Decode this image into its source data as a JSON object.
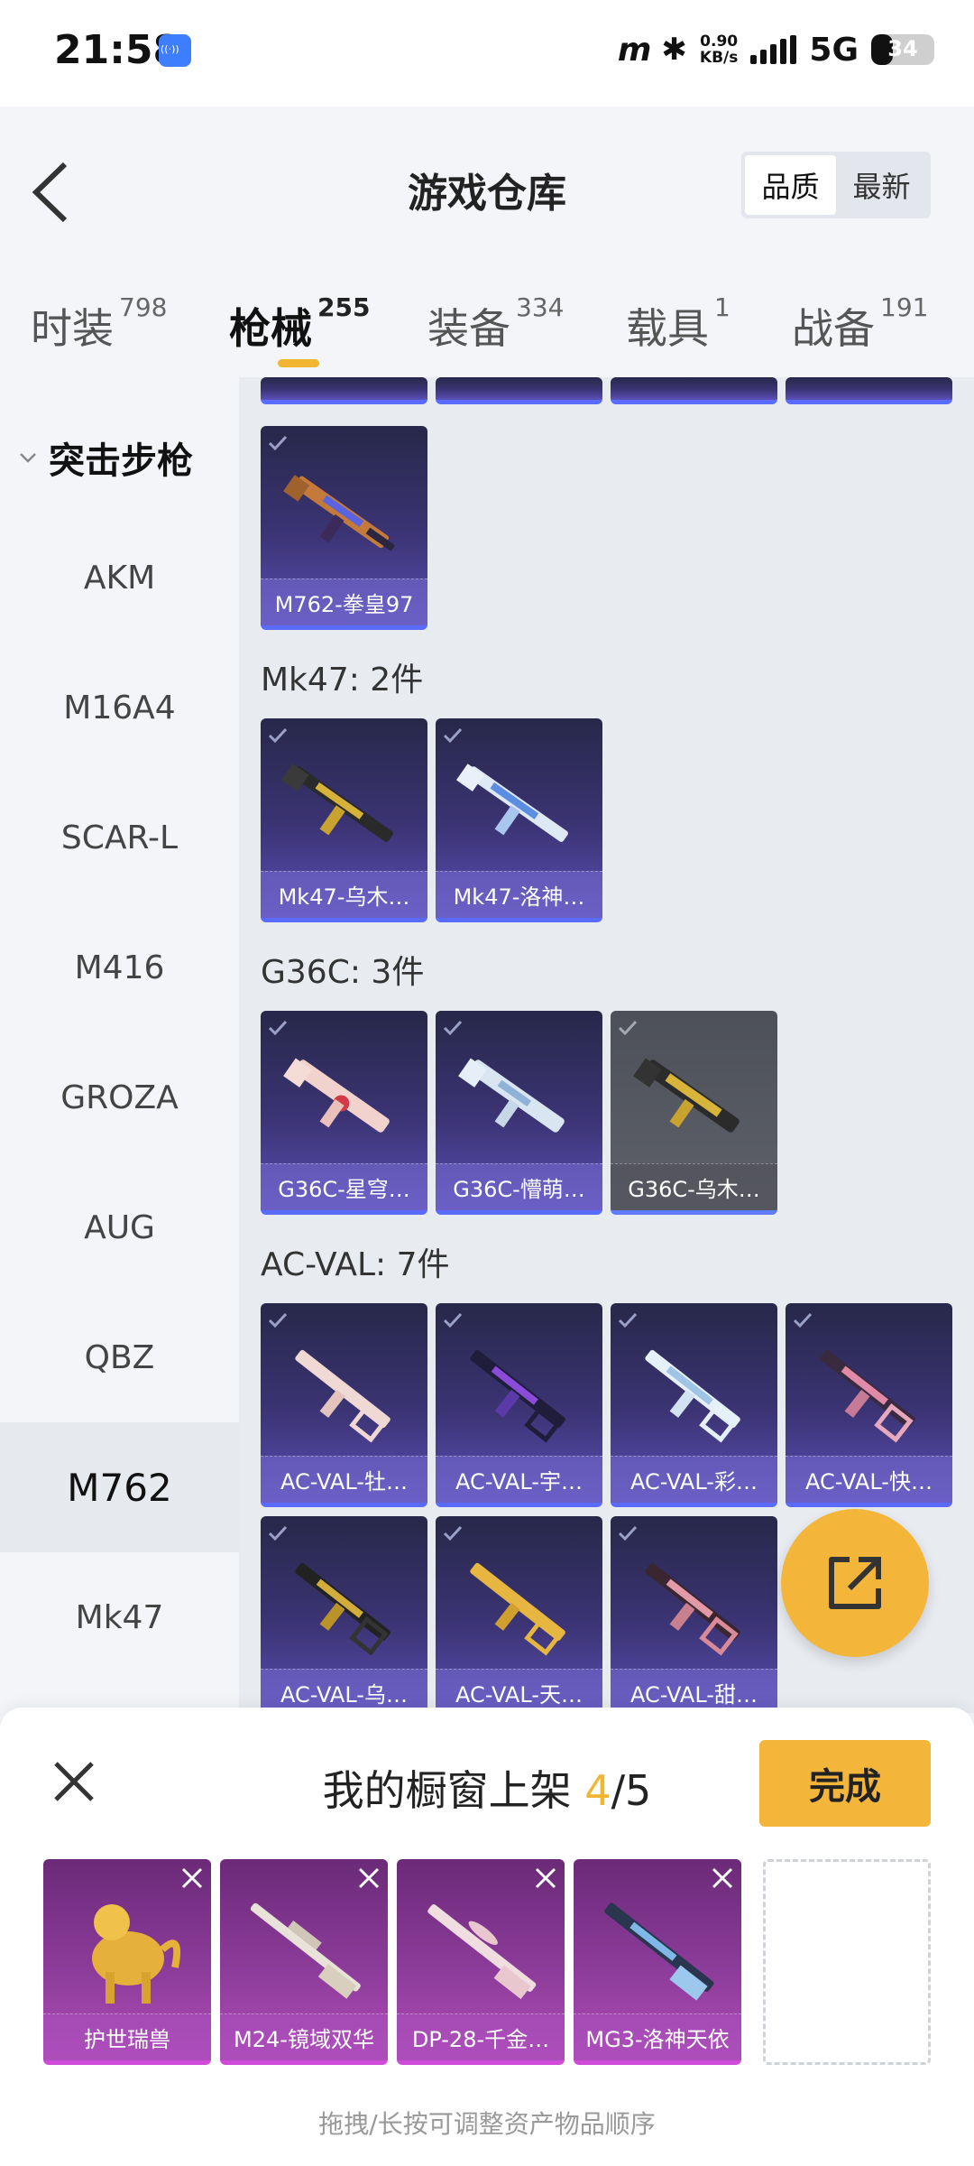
{
  "status_bar": {
    "time": "21:58",
    "speed_value": "0.90",
    "speed_unit": "KB/s",
    "network": "5G",
    "battery": "34",
    "battery_level": 0.34
  },
  "header": {
    "title": "游戏仓库",
    "sort_options": [
      "品质",
      "最新"
    ],
    "sort_selected": "品质"
  },
  "tabs": [
    {
      "label": "时装",
      "count": "798"
    },
    {
      "label": "枪械",
      "count": "255",
      "active": true
    },
    {
      "label": "装备",
      "count": "334"
    },
    {
      "label": "载具",
      "count": "1"
    },
    {
      "label": "战备",
      "count": "191"
    }
  ],
  "sidebar": {
    "group": "突击步枪",
    "items": [
      "AKM",
      "M16A4",
      "SCAR-L",
      "M416",
      "GROZA",
      "AUG",
      "QBZ",
      "M762",
      "Mk47"
    ],
    "active": "M762"
  },
  "sections": [
    {
      "title": "Mk47: 2件",
      "items": [
        "Mk47-乌木…",
        "Mk47-洛神…"
      ]
    },
    {
      "title": "G36C: 3件",
      "items": [
        "G36C-星穹…",
        "G36C-懵萌…",
        "G36C-乌木…"
      ]
    },
    {
      "title": "AC-VAL: 7件",
      "items": [
        "AC-VAL-牡…",
        "AC-VAL-宇…",
        "AC-VAL-彩…",
        "AC-VAL-快…",
        "AC-VAL-乌…",
        "AC-VAL-天…",
        "AC-VAL-甜…"
      ]
    }
  ],
  "m762_last": "M762-拳皇97",
  "sheet": {
    "title_prefix": "我的橱窗上架 ",
    "count": "4",
    "total": "/5",
    "done_label": "完成",
    "items": [
      "护世瑞兽",
      "M24-镜域双华",
      "DP-28-千金…",
      "MG3-洛神天依"
    ],
    "hint": "拖拽/长按可调整资产物品顺序"
  },
  "colors": {
    "accent": "#f4b63a",
    "card_purple": "#3c3475",
    "card_grey": "#5e616a",
    "shelf_magenta": "#8c3c9a"
  }
}
